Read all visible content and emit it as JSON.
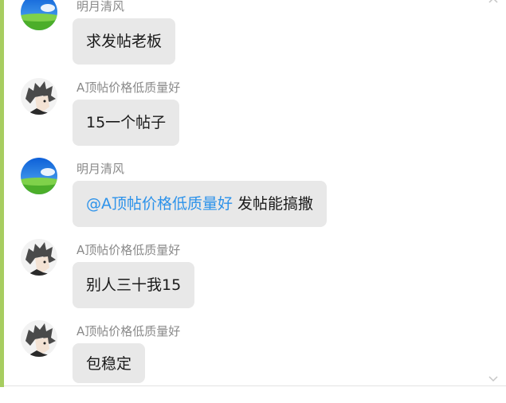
{
  "messages": [
    {
      "sender": "明月清风",
      "avatar": "landscape",
      "text": "求发帖老板",
      "mention": ""
    },
    {
      "sender": "A顶帖价格低质量好",
      "avatar": "anime",
      "text": "15一个帖子",
      "mention": ""
    },
    {
      "sender": "明月清风",
      "avatar": "landscape",
      "text": "发帖能搞撒",
      "mention": "@A顶帖价格低质量好"
    },
    {
      "sender": "A顶帖价格低质量好",
      "avatar": "anime",
      "text": "别人三十我15",
      "mention": ""
    },
    {
      "sender": "A顶帖价格低质量好",
      "avatar": "anime",
      "text": "包稳定",
      "mention": ""
    }
  ],
  "colors": {
    "left_bar": "#a7cd60",
    "bubble": "#e8e8e8",
    "mention": "#2c92ea",
    "sender": "#8a8a8a"
  },
  "icons": [
    "scroll-up-icon",
    "scroll-down-icon",
    "landscape-avatar",
    "anime-avatar"
  ]
}
